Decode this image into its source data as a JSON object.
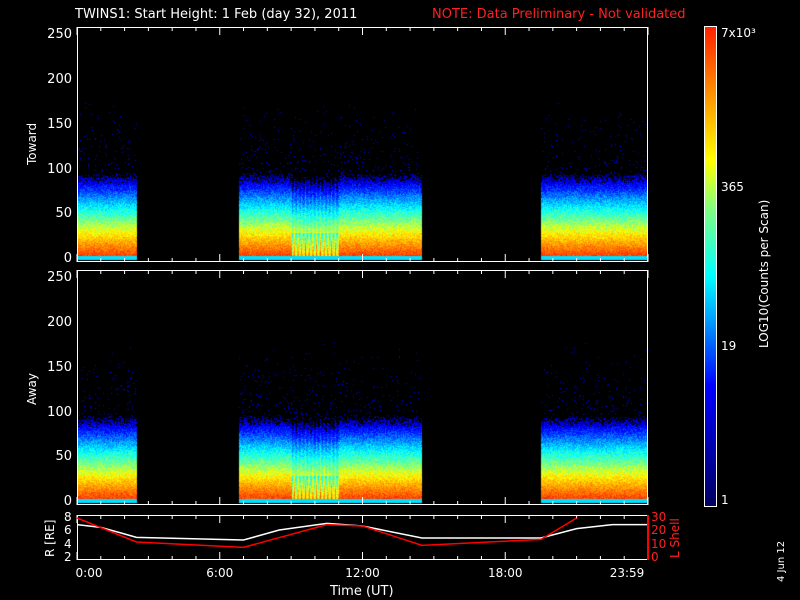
{
  "header": {
    "title": "TWINS1: Start Height:  1 Feb (day  32), 2011",
    "note": "NOTE: Data Preliminary - Not validated"
  },
  "footer": {
    "date_stamp": "4 Jun 12"
  },
  "colors": {
    "note": "#ff2020",
    "r_line": "#ffffff",
    "lshell_line": "#ff0000"
  },
  "chart_data": [
    {
      "type": "heatmap",
      "name": "Toward",
      "ylabel": "Toward",
      "ylim": [
        0,
        255
      ],
      "yticks": [
        "0",
        "50",
        "100",
        "150",
        "200",
        "250"
      ],
      "xlim_hours": [
        0,
        24
      ],
      "data_intervals_hours": [
        [
          0,
          2.5
        ],
        [
          6.8,
          14.5
        ],
        [
          19.5,
          24
        ]
      ],
      "description": "counts highest at low channels, falling off above ~100"
    },
    {
      "type": "heatmap",
      "name": "Away",
      "ylabel": "Away",
      "ylim": [
        0,
        255
      ],
      "yticks": [
        "0",
        "50",
        "100",
        "150",
        "200",
        "250"
      ],
      "xlim_hours": [
        0,
        24
      ],
      "data_intervals_hours": [
        [
          0,
          2.5
        ],
        [
          6.8,
          14.5
        ],
        [
          19.5,
          24
        ]
      ]
    },
    {
      "type": "line",
      "name": "orbit",
      "xlabel": "Time (UT)",
      "xticks": [
        "0:00",
        "6:00",
        "12:00",
        "18:00",
        "23:59"
      ],
      "ylabel": "R [RE]",
      "ylim": [
        2,
        8
      ],
      "yticks": [
        "2",
        "4",
        "6",
        "8"
      ],
      "y2label": "L Shell",
      "y2lim": [
        0,
        30
      ],
      "y2ticks": [
        "0",
        "10",
        "20",
        "30"
      ],
      "series": [
        {
          "name": "R",
          "axis": "left",
          "x": [
            0,
            1,
            2.5,
            7,
            8.5,
            10.5,
            12,
            14.5,
            19.5,
            21,
            22.5,
            24
          ],
          "y": [
            7,
            6.6,
            5.1,
            4.7,
            6.2,
            7.2,
            6.8,
            5.0,
            5.0,
            6.4,
            7.0,
            7.0
          ]
        },
        {
          "name": "L Shell",
          "axis": "right",
          "x": [
            0,
            2.5,
            7,
            10.5,
            12,
            14.5,
            19.5,
            21
          ],
          "y": [
            30,
            12,
            8,
            25,
            24,
            9.5,
            14,
            30
          ]
        }
      ]
    },
    {
      "type": "colorbar",
      "label": "LOG10(Counts per Scan)",
      "ticks": [
        "1",
        "19",
        "365",
        "7x10³"
      ]
    }
  ]
}
